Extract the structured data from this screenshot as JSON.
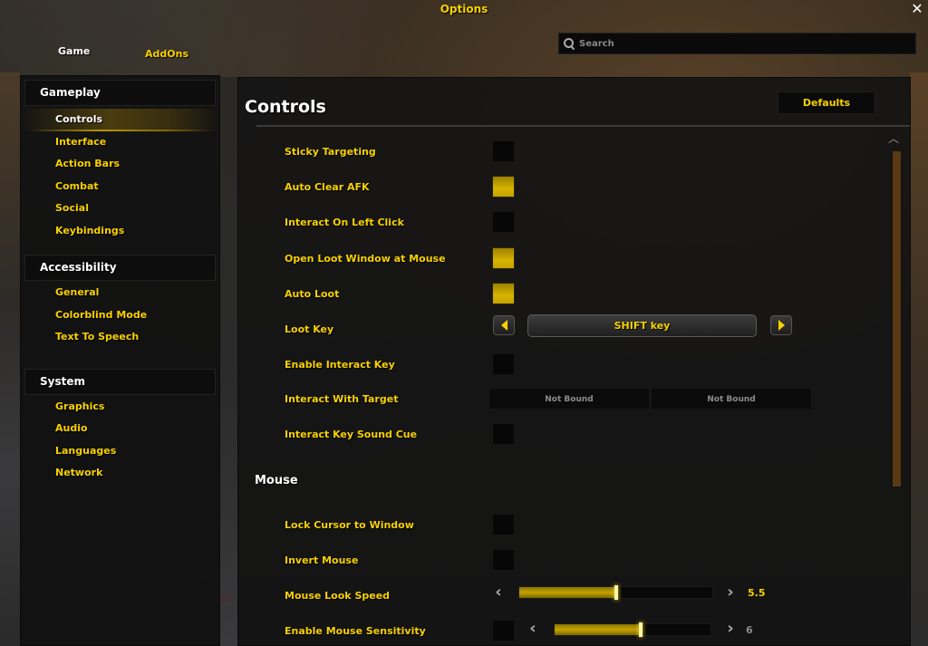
{
  "window": {
    "title": "Options",
    "close_icon": "close-icon"
  },
  "top_tabs": [
    {
      "label": "Game",
      "active": true
    },
    {
      "label": "AddOns",
      "active": false
    }
  ],
  "search": {
    "placeholder": "Search",
    "value": ""
  },
  "sidebar": {
    "groups": [
      {
        "header": "Gameplay",
        "items": [
          {
            "label": "Controls",
            "selected": true
          },
          {
            "label": "Interface"
          },
          {
            "label": "Action Bars"
          },
          {
            "label": "Combat"
          },
          {
            "label": "Social"
          },
          {
            "label": "Keybindings"
          }
        ]
      },
      {
        "header": "Accessibility",
        "items": [
          {
            "label": "General"
          },
          {
            "label": "Colorblind Mode"
          },
          {
            "label": "Text To Speech"
          }
        ]
      },
      {
        "header": "System",
        "items": [
          {
            "label": "Graphics"
          },
          {
            "label": "Audio"
          },
          {
            "label": "Languages"
          },
          {
            "label": "Network"
          }
        ]
      }
    ]
  },
  "content": {
    "title": "Controls",
    "defaults_label": "Defaults",
    "settings": [
      {
        "label": "Sticky Targeting",
        "type": "checkbox",
        "checked": false
      },
      {
        "label": "Auto Clear AFK",
        "type": "checkbox",
        "checked": true
      },
      {
        "label": "Interact On Left Click",
        "type": "checkbox",
        "checked": false
      },
      {
        "label": "Open Loot Window at Mouse",
        "type": "checkbox",
        "checked": true
      },
      {
        "label": "Auto Loot",
        "type": "checkbox",
        "checked": true
      },
      {
        "label": "Loot Key",
        "type": "dropdown",
        "value": "SHIFT key"
      },
      {
        "label": "Enable Interact Key",
        "type": "checkbox",
        "checked": false
      },
      {
        "label": "Interact With Target",
        "type": "keybind",
        "bindings": [
          "Not Bound",
          "Not Bound"
        ]
      },
      {
        "label": "Interact Key Sound Cue",
        "type": "checkbox",
        "checked": false
      }
    ],
    "mouse_section": {
      "header": "Mouse",
      "settings": [
        {
          "label": "Lock Cursor to Window",
          "type": "checkbox",
          "checked": false
        },
        {
          "label": "Invert Mouse",
          "type": "checkbox",
          "checked": false
        },
        {
          "label": "Mouse Look Speed",
          "type": "slider",
          "value": "5.5",
          "fill_fraction": 0.5,
          "enabled": true
        },
        {
          "label": "Enable Mouse Sensitivity",
          "type": "checkbox+slider",
          "checked": false,
          "value": "6",
          "fill_fraction": 0.55,
          "enabled": false
        }
      ]
    }
  },
  "colors": {
    "accent_gold": "#f8d100",
    "checked_fill": "#d6b400",
    "scrollbar_thumb": "#5a3a14",
    "disabled_text": "#8c8c8c"
  },
  "background_overlays": [
    "100",
    "0",
    "0/100"
  ]
}
